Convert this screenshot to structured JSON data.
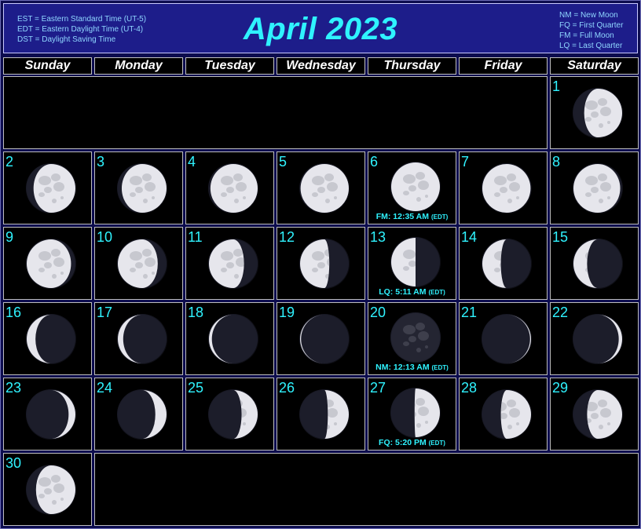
{
  "header": {
    "title": "April 2023",
    "legend_left": [
      "EST = Eastern Standard Time (UT-5)",
      "EDT = Eastern Daylight Time (UT-4)",
      "DST = Daylight Saving Time"
    ],
    "legend_right": [
      "NM = New Moon",
      "FQ = First Quarter",
      "FM = Full Moon",
      "LQ = Last Quarter"
    ]
  },
  "weekdays": [
    "Sunday",
    "Monday",
    "Tuesday",
    "Wednesday",
    "Thursday",
    "Friday",
    "Saturday"
  ],
  "first_weekday_index": 6,
  "days": [
    {
      "day": "1",
      "illum": 0.78,
      "waxing": true
    },
    {
      "day": "2",
      "illum": 0.86,
      "waxing": true
    },
    {
      "day": "3",
      "illum": 0.92,
      "waxing": true
    },
    {
      "day": "4",
      "illum": 0.97,
      "waxing": true
    },
    {
      "day": "5",
      "illum": 0.99,
      "waxing": true
    },
    {
      "day": "6",
      "illum": 1.0,
      "waxing": true,
      "phase": "FM: 12:35 AM",
      "zone": "(EDT)"
    },
    {
      "day": "7",
      "illum": 0.99,
      "waxing": false
    },
    {
      "day": "8",
      "illum": 0.96,
      "waxing": false
    },
    {
      "day": "9",
      "illum": 0.91,
      "waxing": false
    },
    {
      "day": "10",
      "illum": 0.82,
      "waxing": false
    },
    {
      "day": "11",
      "illum": 0.72,
      "waxing": false
    },
    {
      "day": "12",
      "illum": 0.6,
      "waxing": false
    },
    {
      "day": "13",
      "illum": 0.5,
      "waxing": false,
      "phase": "LQ: 5:11 AM",
      "zone": "(EDT)"
    },
    {
      "day": "14",
      "illum": 0.38,
      "waxing": false
    },
    {
      "day": "15",
      "illum": 0.28,
      "waxing": false
    },
    {
      "day": "16",
      "illum": 0.18,
      "waxing": false
    },
    {
      "day": "17",
      "illum": 0.11,
      "waxing": false
    },
    {
      "day": "18",
      "illum": 0.06,
      "waxing": false
    },
    {
      "day": "19",
      "illum": 0.02,
      "waxing": false
    },
    {
      "day": "20",
      "illum": 0.0,
      "waxing": true,
      "phase": "NM: 12:13 AM",
      "zone": "(EDT)"
    },
    {
      "day": "21",
      "illum": 0.02,
      "waxing": true
    },
    {
      "day": "22",
      "illum": 0.07,
      "waxing": true
    },
    {
      "day": "23",
      "illum": 0.14,
      "waxing": true
    },
    {
      "day": "24",
      "illum": 0.23,
      "waxing": true
    },
    {
      "day": "25",
      "illum": 0.33,
      "waxing": true
    },
    {
      "day": "26",
      "illum": 0.43,
      "waxing": true
    },
    {
      "day": "27",
      "illum": 0.52,
      "waxing": true,
      "phase": "FQ: 5:20 PM",
      "zone": "(EDT)"
    },
    {
      "day": "28",
      "illum": 0.62,
      "waxing": true
    },
    {
      "day": "29",
      "illum": 0.72,
      "waxing": true
    },
    {
      "day": "30",
      "illum": 0.81,
      "waxing": true
    }
  ],
  "colors": {
    "accent": "#2ff3ff",
    "header_bg": "#1d1d8a",
    "cell_bg": "#000000",
    "moon_lit": "#e6e6ec",
    "moon_dark": "#1c1d2a"
  }
}
